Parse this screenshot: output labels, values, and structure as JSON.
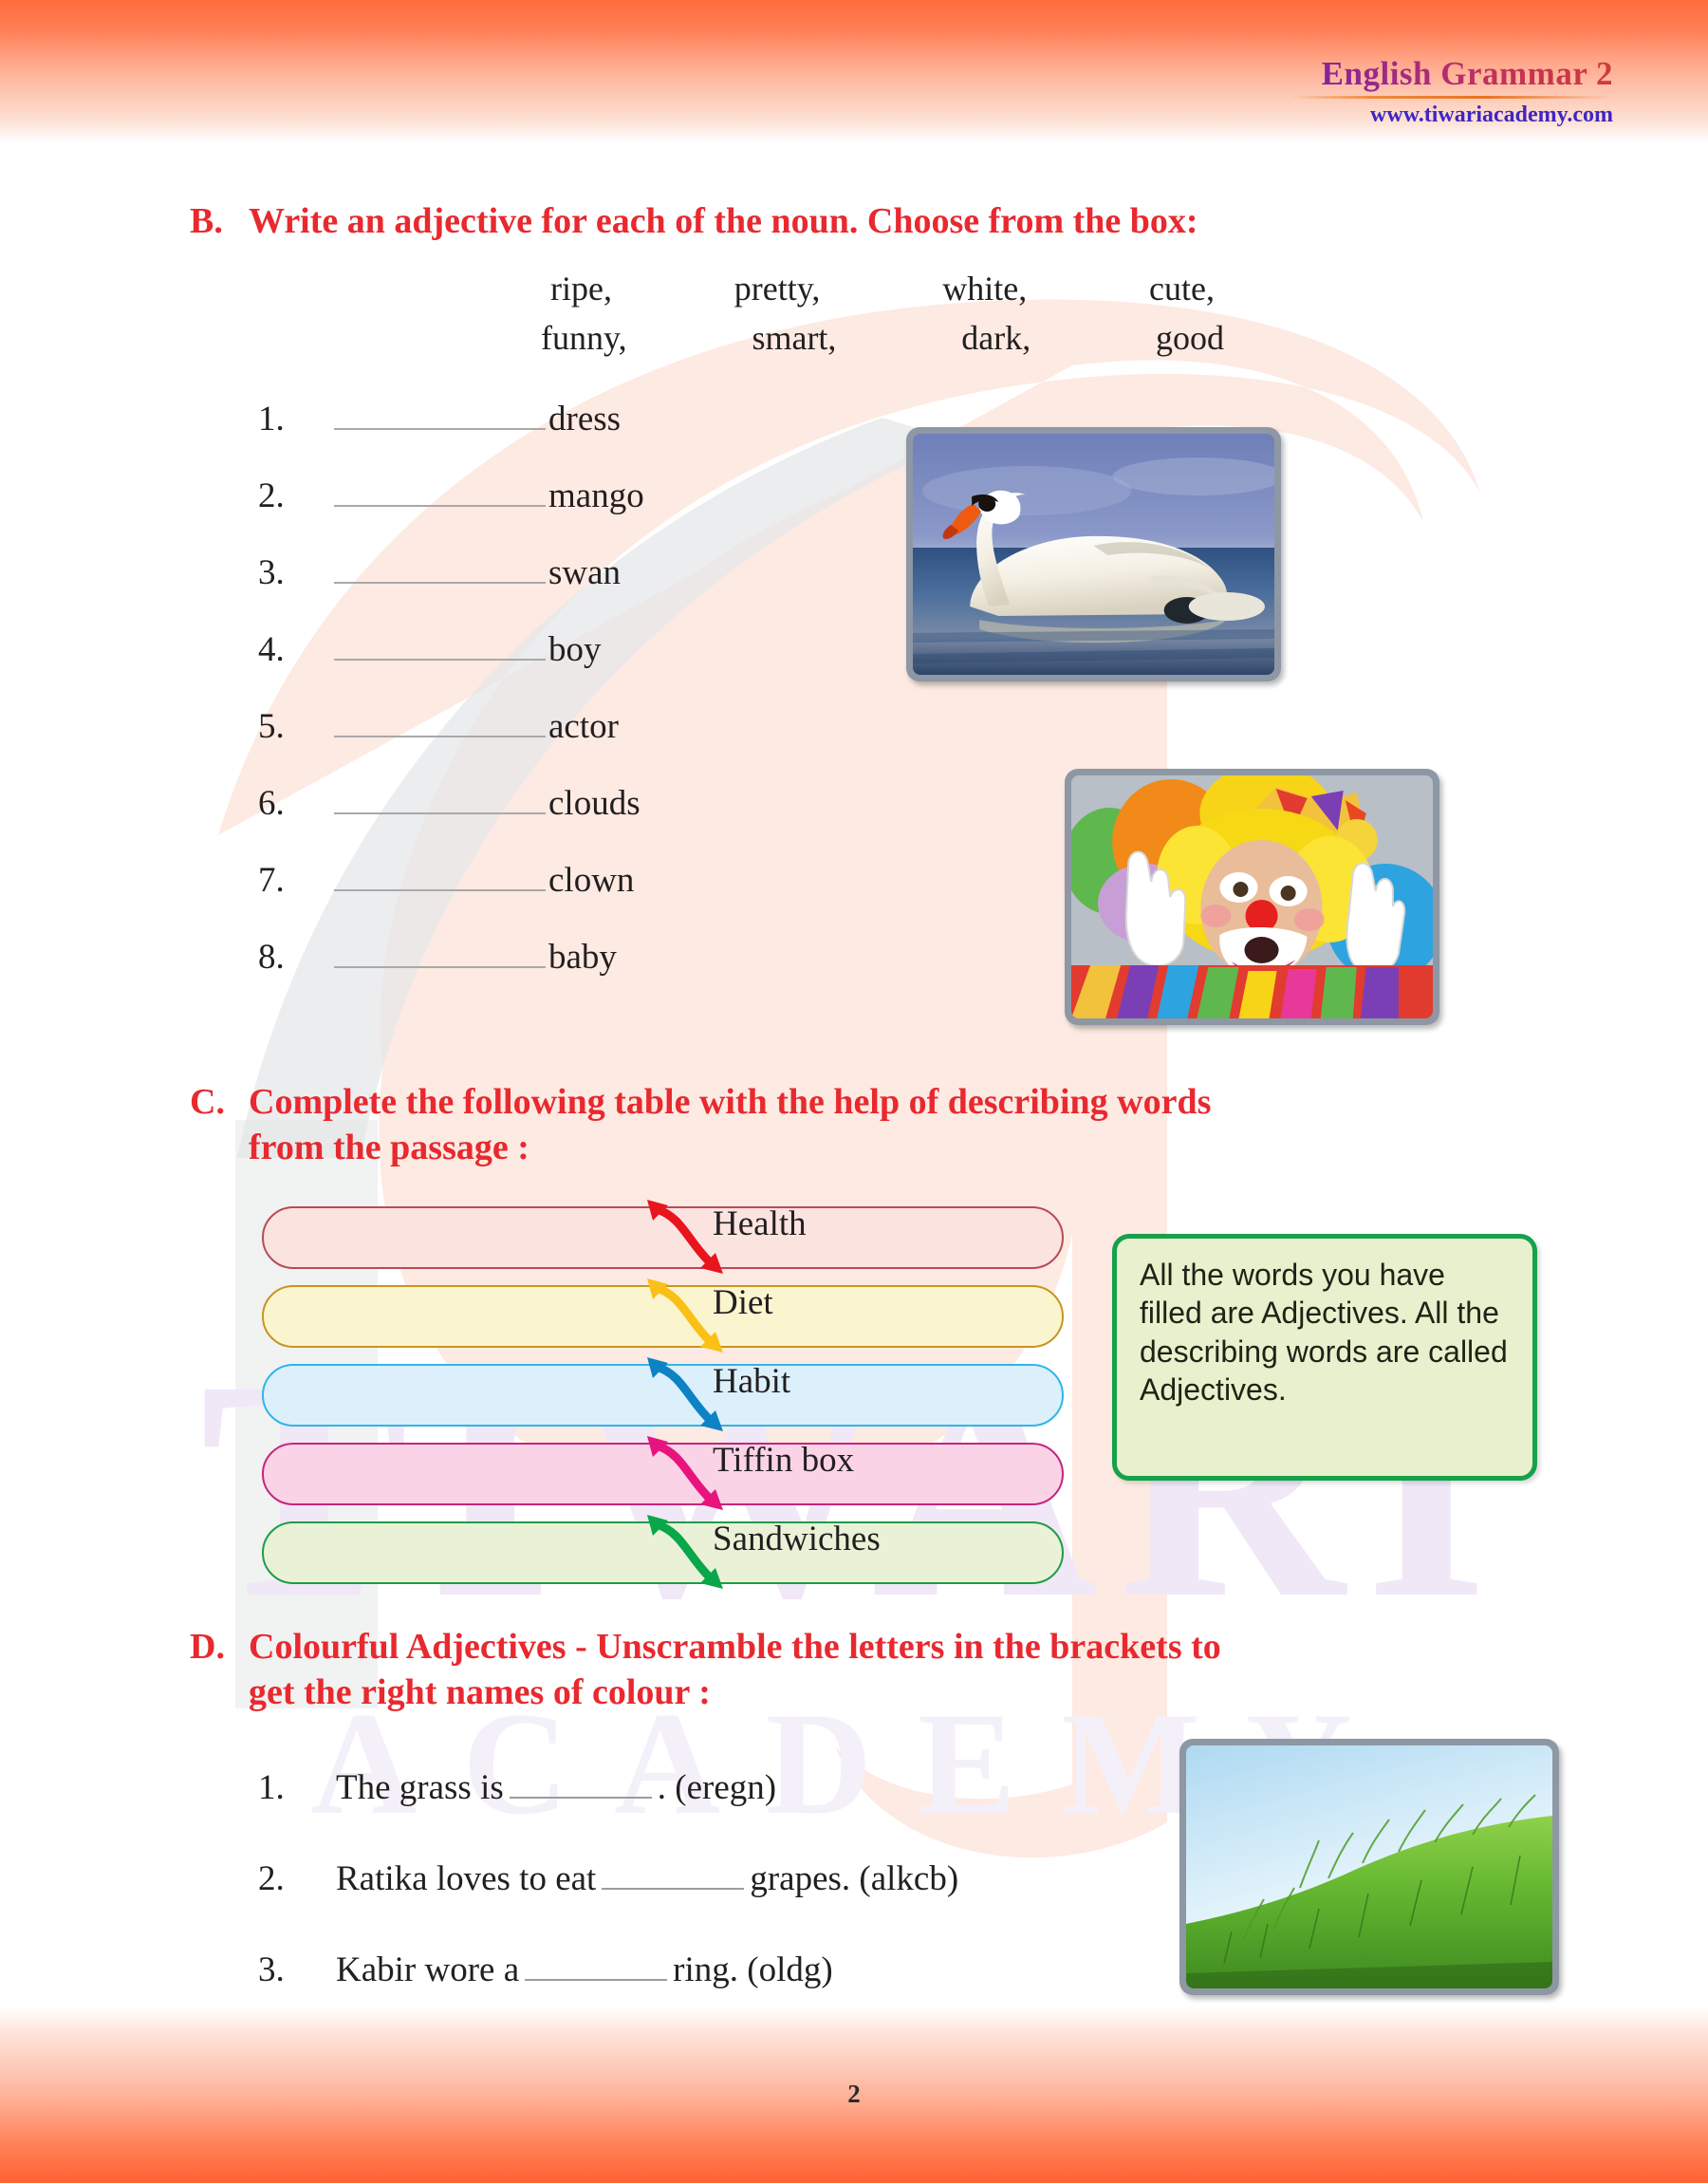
{
  "header": {
    "title": "English Grammar 2",
    "site": "www.tiwariacademy.com"
  },
  "sections": {
    "b": {
      "letter": "B.",
      "heading": "Write an adjective for each of the noun. Choose from the box:",
      "word_box_row1": [
        "ripe,",
        "pretty,",
        "white,",
        "cute,"
      ],
      "word_box_row2": [
        "funny,",
        "smart,",
        "dark,",
        "good"
      ],
      "items": [
        {
          "num": "1.",
          "word": "dress"
        },
        {
          "num": "2.",
          "word": "mango"
        },
        {
          "num": "3.",
          "word": "swan"
        },
        {
          "num": "4.",
          "word": "boy"
        },
        {
          "num": "5.",
          "word": "actor"
        },
        {
          "num": "6.",
          "word": "clouds"
        },
        {
          "num": "7.",
          "word": "clown"
        },
        {
          "num": "8.",
          "word": "baby"
        }
      ]
    },
    "c": {
      "letter": "C.",
      "heading_line1": "Complete the following table with the help of describing words",
      "heading_line2": "from the passage :",
      "rows": [
        {
          "label": "Health",
          "border": "#b94a58",
          "fill": "#fbe4e0",
          "arrow": "#e8151f"
        },
        {
          "label": "Diet",
          "border": "#c8951f",
          "fill": "#fbf5cf",
          "arrow": "#fbc017"
        },
        {
          "label": "Habit",
          "border": "#2fb6e8",
          "fill": "#dcf0fb",
          "arrow": "#0d82c5"
        },
        {
          "label": "Tiffin box",
          "border": "#c4267e",
          "fill": "#fbd3e6",
          "arrow": "#e8147e"
        },
        {
          "label": "Sandwiches",
          "border": "#1f9c4a",
          "fill": "#e9f2d6",
          "arrow": "#0aa64a"
        }
      ],
      "note": "All the words you have filled are Adjectives. All the describing words are called Adjectives."
    },
    "d": {
      "letter": "D.",
      "heading_line1": "Colourful Adjectives - Unscramble the letters in the brackets to",
      "heading_line2": "get the right names of colour  :",
      "items": [
        {
          "num": "1.",
          "before": "The grass is",
          "after": ". (eregn)"
        },
        {
          "num": "2.",
          "before": "Ratika loves to eat",
          "after": "grapes. (alkcb)"
        },
        {
          "num": "3.",
          "before": "Kabir wore a",
          "after": "ring. (oldg)"
        }
      ]
    }
  },
  "photos": {
    "swan": "swan-photo",
    "clown": "clown-photo",
    "grass": "grass-photo"
  },
  "watermark": {
    "brand_letter": "T",
    "brand_word": "TIWARI",
    "brand_subword": "ACADEMY"
  },
  "footer": {
    "page_number": "2"
  },
  "colors": {
    "heading_red": "#e8292f",
    "band_orange": "#ff6b3d",
    "site_blue": "#3f25c4",
    "note_green": "#16a14b",
    "note_fill": "#e9f0cd"
  }
}
